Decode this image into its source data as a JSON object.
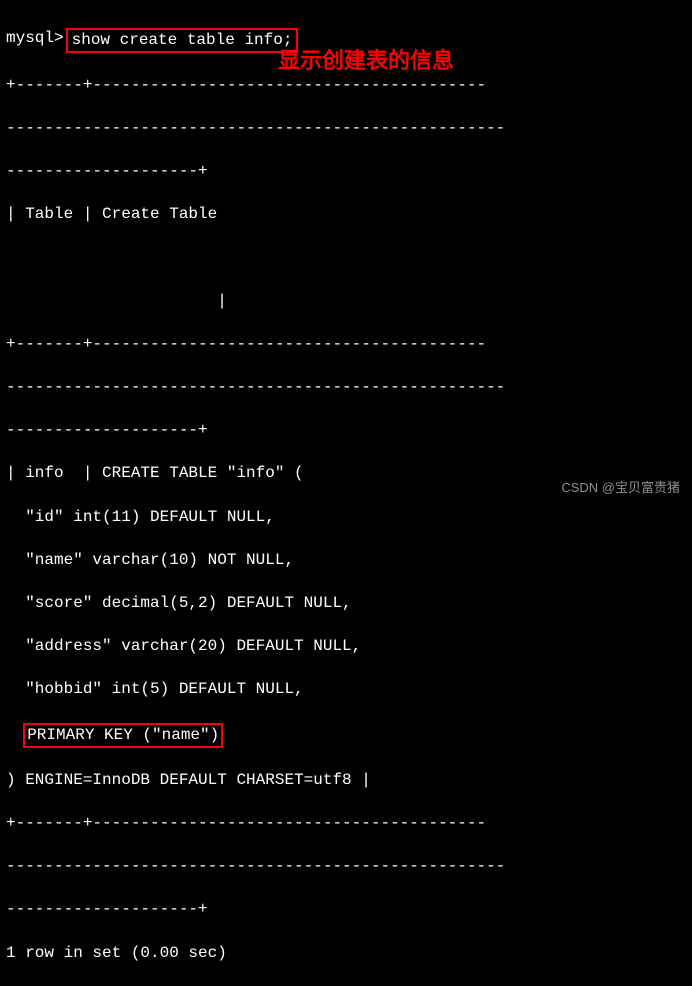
{
  "prompt": "mysql>",
  "command": "show create table info;",
  "annotation": "显示创建表的信息",
  "sep1": "+-------+-----------------------------------------",
  "sep1b": "----------------------------------------------------",
  "sep1c": "--------------------+",
  "hdr": "| Table | Create Table",
  "hdr_end": "                      |",
  "tbl_name": "| info  | CREATE TABLE \"info\" (",
  "col_id": "  \"id\" int(11) DEFAULT NULL,",
  "col_name": "  \"name\" varchar(10) NOT NULL,",
  "col_score": "  \"score\" decimal(5,2) DEFAULT NULL,",
  "col_address": "  \"address\" varchar(20) DEFAULT NULL,",
  "col_hobbid": "  \"hobbid\" int(5) DEFAULT NULL,",
  "pk_indent": "  ",
  "pk": "PRIMARY KEY (\"name\")",
  "engine": ") ENGINE=InnoDB DEFAULT CHARSET=utf8 |",
  "footer": "1 row in set (0.00 sec)",
  "watermark": "CSDN @宝贝富贵猪"
}
